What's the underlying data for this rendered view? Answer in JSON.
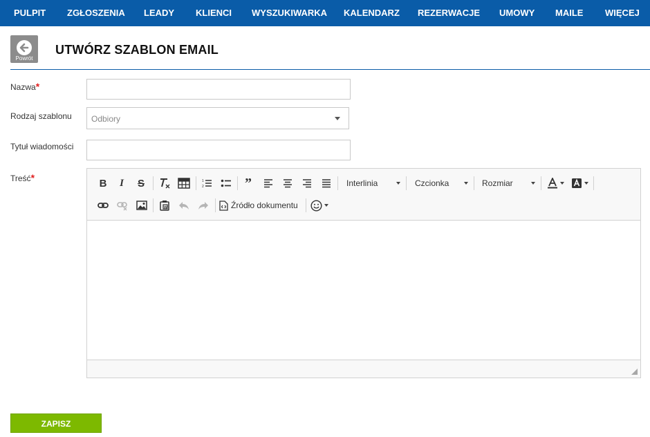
{
  "nav": {
    "items": [
      "PULPIT",
      "ZGŁOSZENIA",
      "LEADY",
      "KLIENCI",
      "WYSZUKIWARKA",
      "KALENDARZ",
      "REZERWACJE",
      "UMOWY",
      "MAILE",
      "WIĘCEJ"
    ]
  },
  "header": {
    "back_label": "Powrót",
    "title": "UTWÓRZ SZABLON EMAIL"
  },
  "form": {
    "name_label": "Nazwa",
    "name_value": "",
    "type_label": "Rodzaj szablonu",
    "type_value": "Odbiory",
    "subject_label": "Tytuł wiadomości",
    "subject_value": "",
    "content_label": "Treść",
    "required_mark": "*"
  },
  "editor": {
    "line_height_label": "Interlinia",
    "font_label": "Czcionka",
    "size_label": "Rozmiar",
    "source_label": "Źródło dokumentu",
    "icons": [
      "bold-icon",
      "italic-icon",
      "strikethrough-icon",
      "remove-format-icon",
      "table-icon",
      "numbered-list-icon",
      "bulleted-list-icon",
      "blockquote-icon",
      "align-left-icon",
      "align-center-icon",
      "align-right-icon",
      "justify-icon",
      "text-color-icon",
      "background-color-icon",
      "link-icon",
      "unlink-icon",
      "image-icon",
      "paste-word-icon",
      "undo-icon",
      "redo-icon",
      "source-icon",
      "emoji-icon"
    ]
  },
  "actions": {
    "save_label": "ZAPISZ"
  },
  "colors": {
    "nav_bg": "#0a5ca8",
    "save_bg": "#7db900",
    "required": "#e02020"
  }
}
